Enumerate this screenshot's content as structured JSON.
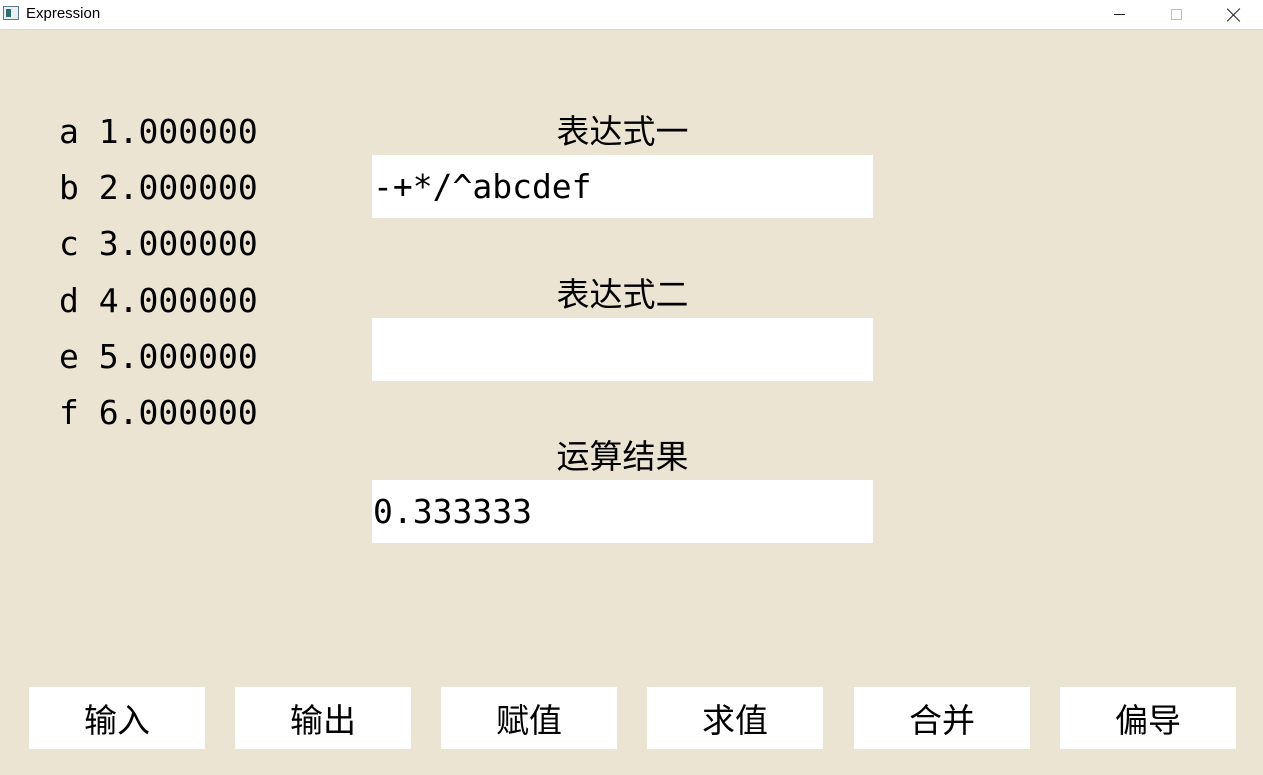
{
  "window": {
    "title": "Expression"
  },
  "variables": [
    {
      "name": "a",
      "value": "1.000000"
    },
    {
      "name": "b",
      "value": "2.000000"
    },
    {
      "name": "c",
      "value": "3.000000"
    },
    {
      "name": "d",
      "value": "4.000000"
    },
    {
      "name": "e",
      "value": "5.000000"
    },
    {
      "name": "f",
      "value": "6.000000"
    }
  ],
  "expression1": {
    "label": "表达式一",
    "value": "-+*/^abcdef"
  },
  "expression2": {
    "label": "表达式二",
    "value": ""
  },
  "result": {
    "label": "运算结果",
    "value": "0.333333"
  },
  "buttons": [
    {
      "label": "输入"
    },
    {
      "label": "输出"
    },
    {
      "label": "赋值"
    },
    {
      "label": "求值"
    },
    {
      "label": "合并"
    },
    {
      "label": "偏导"
    }
  ]
}
